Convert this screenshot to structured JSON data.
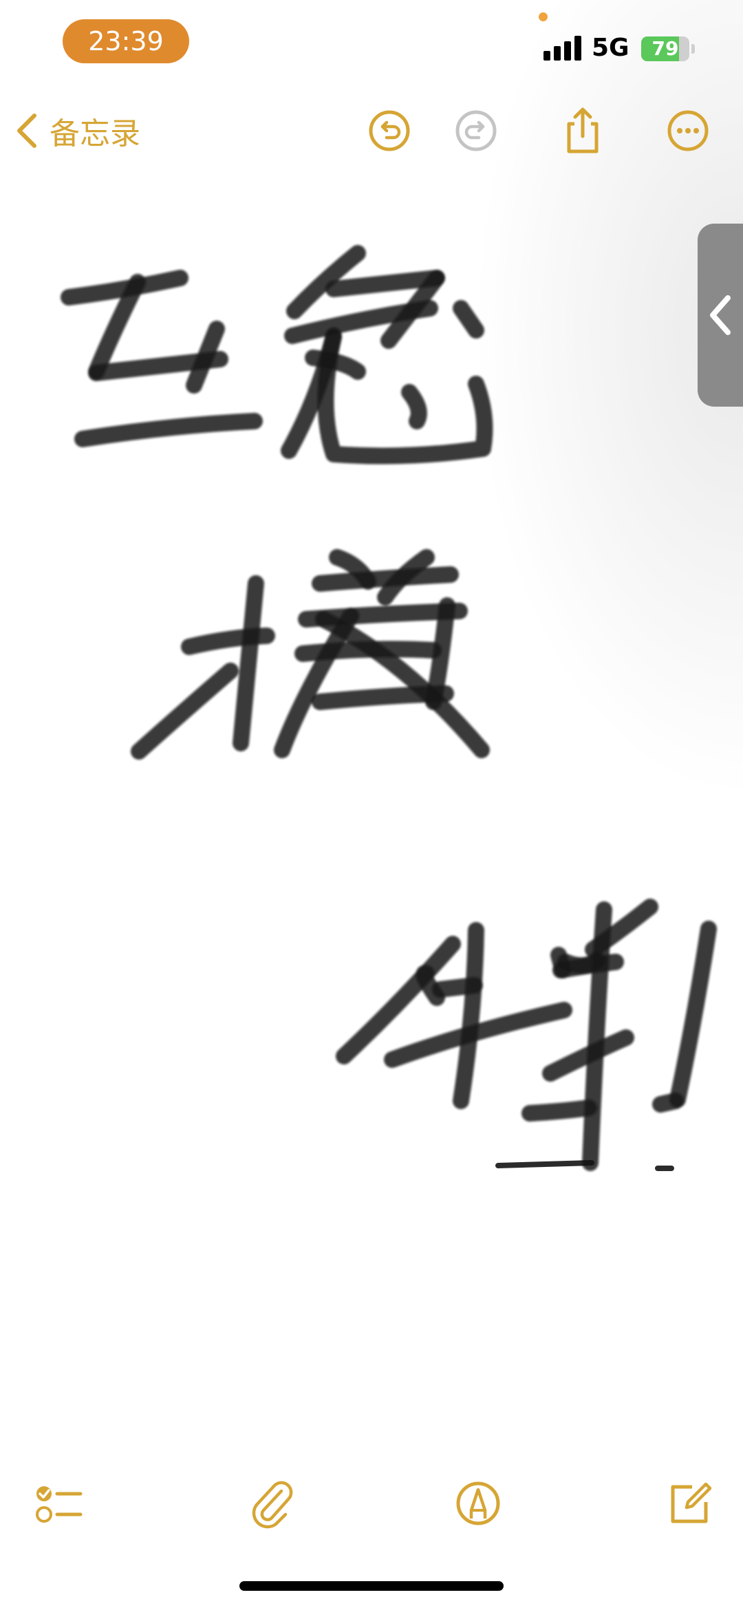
{
  "status_bar": {
    "time": "23:39",
    "network": "5G",
    "battery_percent": 79,
    "battery_label": "79",
    "signal_bars": 4
  },
  "nav": {
    "back_label": "备忘录",
    "icons": [
      "undo-icon",
      "redo-icon",
      "share-icon",
      "more-icon"
    ]
  },
  "note": {
    "content_type": "handwriting-drawing",
    "ink_color": "#141414"
  },
  "toolbar": {
    "icons": [
      "checklist-icon",
      "attachment-icon",
      "markup-icon",
      "compose-icon"
    ]
  },
  "colors": {
    "accent": "#d6a534",
    "time_pill": "#e08a2e",
    "battery_fill": "#5ac85a",
    "disabled": "#c4c4c4",
    "side_tab": "#8a8a8a"
  }
}
